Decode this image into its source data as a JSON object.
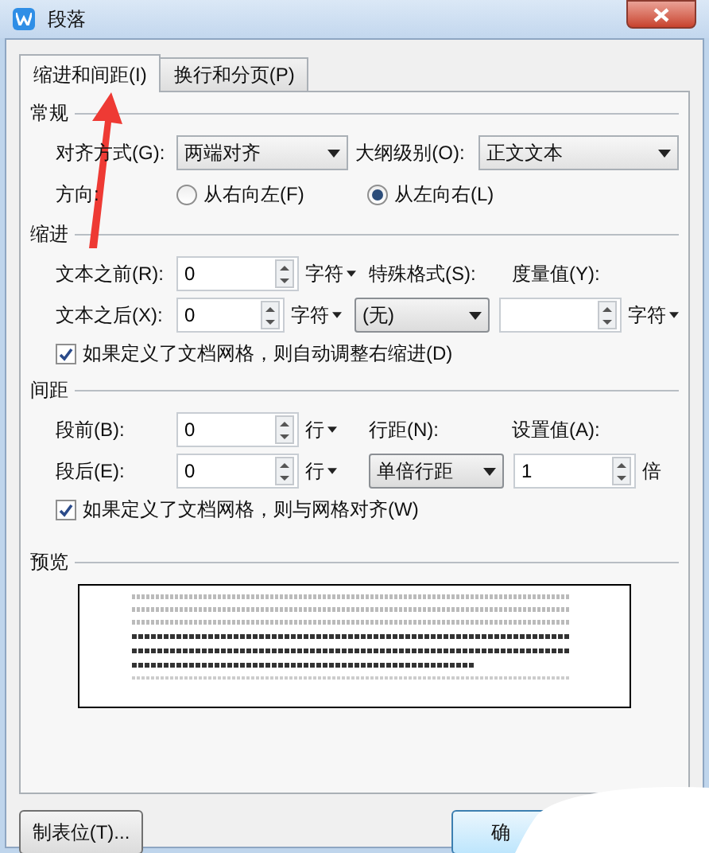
{
  "window": {
    "title": "段落"
  },
  "tabs": [
    {
      "label": "缩进和间距(I)",
      "selected": true
    },
    {
      "label": "换行和分页(P)",
      "selected": false
    }
  ],
  "general": {
    "title": "常规",
    "alignment": {
      "label": "对齐方式(G):",
      "value": "两端对齐"
    },
    "outline_level": {
      "label": "大纲级别(O):",
      "value": "正文文本"
    },
    "direction": {
      "label": "方向:",
      "options": [
        {
          "label": "从右向左(F)",
          "selected": false
        },
        {
          "label": "从左向右(L)",
          "selected": true
        }
      ]
    }
  },
  "indent": {
    "title": "缩进",
    "before": {
      "label": "文本之前(R):",
      "value": "0",
      "unit": "字符"
    },
    "after": {
      "label": "文本之后(X):",
      "value": "0",
      "unit": "字符"
    },
    "special": {
      "label": "特殊格式(S):",
      "value": "(无)"
    },
    "measure": {
      "label": "度量值(Y):",
      "unit": "字符"
    },
    "auto_adjust": {
      "label": "如果定义了文档网格，则自动调整右缩进(D)",
      "checked": true
    }
  },
  "spacing": {
    "title": "间距",
    "before": {
      "label": "段前(B):",
      "value": "0",
      "unit": "行"
    },
    "after": {
      "label": "段后(E):",
      "value": "0",
      "unit": "行"
    },
    "line_spacing": {
      "label": "行距(N):",
      "value": "单倍行距"
    },
    "setting": {
      "label": "设置值(A):",
      "value": "1",
      "unit": "倍"
    },
    "snap_grid": {
      "label": "如果定义了文档网格，则与网格对齐(W)",
      "checked": true
    }
  },
  "preview": {
    "title": "预览"
  },
  "buttons": [
    {
      "label": "制表位(T)..."
    },
    {
      "label": "确"
    }
  ]
}
